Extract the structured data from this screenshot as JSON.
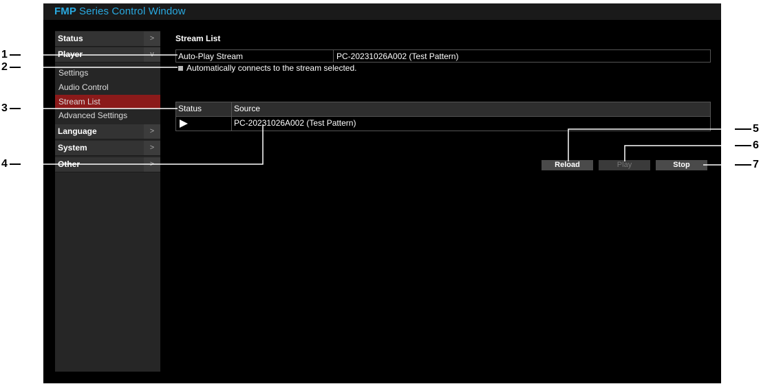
{
  "window": {
    "title_brand": "FMP",
    "title_rest": "Series Control Window"
  },
  "sidebar": {
    "sections": [
      {
        "label": "Status",
        "chevron": ">"
      },
      {
        "label": "Player",
        "chevron": "v"
      },
      {
        "label": "Language",
        "chevron": ">"
      },
      {
        "label": "System",
        "chevron": ">"
      },
      {
        "label": "Other",
        "chevron": ">"
      }
    ],
    "player_items": [
      "Settings",
      "Audio Control",
      "Stream List",
      "Advanced Settings"
    ],
    "active_item": "Stream List"
  },
  "main": {
    "heading": "Stream List",
    "auto_play": {
      "label": "Auto-Play Stream",
      "value": "PC-20231026A002 (Test Pattern)"
    },
    "auto_connect": {
      "checked": true,
      "label": "Automatically connects to the stream selected."
    },
    "stream_table": {
      "columns": [
        "Status",
        "Source"
      ],
      "rows": [
        {
          "status_icon": "play-icon",
          "source": "PC-20231026A002 (Test Pattern)"
        }
      ]
    },
    "buttons": {
      "reload": "Reload",
      "play": "Play",
      "stop": "Stop"
    }
  },
  "callouts": [
    "1",
    "2",
    "3",
    "4",
    "5",
    "6",
    "7"
  ],
  "colors": {
    "title": "#29a9e0",
    "active_nav": "#8b1a1a",
    "background": "#000000"
  }
}
